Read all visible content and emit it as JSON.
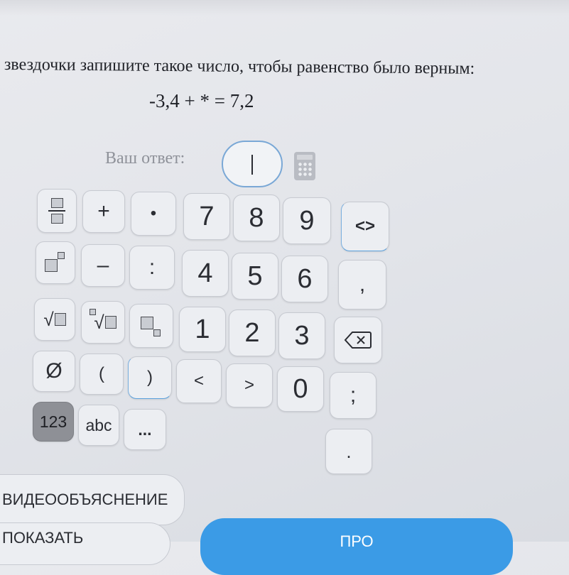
{
  "question": {
    "text": "звездочки запишите такое число, чтобы равенство было верным:",
    "equation": "-3,4 + * = 7,2"
  },
  "answer": {
    "label": "Ваш ответ:",
    "value": ""
  },
  "keypad": {
    "plus": "+",
    "dot": "•",
    "minus": "–",
    "colon": ":",
    "digit_7": "7",
    "digit_8": "8",
    "digit_9": "9",
    "digit_4": "4",
    "digit_5": "5",
    "digit_6": "6",
    "digit_1": "1",
    "digit_2": "2",
    "digit_3": "3",
    "digit_0": "0",
    "cursor_left_right": "<>",
    "comma": ",",
    "empty_set": "Ø",
    "paren_open": "(",
    "paren_close": ")",
    "less": "<",
    "greater": ">",
    "semicolon": ";",
    "mode_numbers": "123",
    "mode_letters": "abc",
    "mode_more": "...",
    "period": "."
  },
  "buttons": {
    "video_explanation": "ВИДЕООБЪЯСНЕНИЕ",
    "show_solution": "ПОКАЗАТЬ",
    "check": "ПРО"
  }
}
